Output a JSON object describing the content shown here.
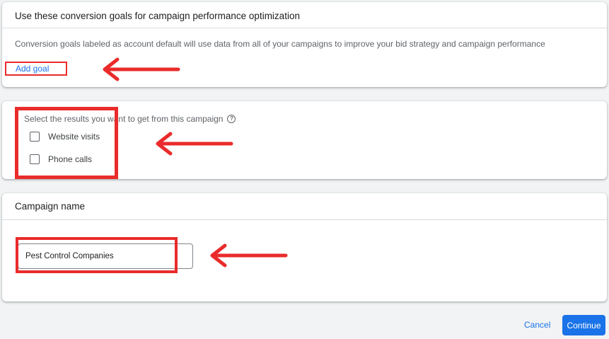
{
  "conversion_goals": {
    "title": "Use these conversion goals for campaign performance optimization",
    "description": "Conversion goals labeled as account default will use data from all of your campaigns to improve your bid strategy and campaign performance",
    "add_goal_label": "Add goal"
  },
  "results": {
    "question": "Select the results you want to get from this campaign",
    "options": [
      {
        "label": "Website visits",
        "checked": false
      },
      {
        "label": "Phone calls",
        "checked": false
      }
    ]
  },
  "campaign_name": {
    "title": "Campaign name",
    "value": "Pest Control Companies"
  },
  "footer": {
    "cancel_label": "Cancel",
    "continue_label": "Continue"
  },
  "colors": {
    "accent": "#1a73e8",
    "annotation": "#ea2b2b"
  }
}
